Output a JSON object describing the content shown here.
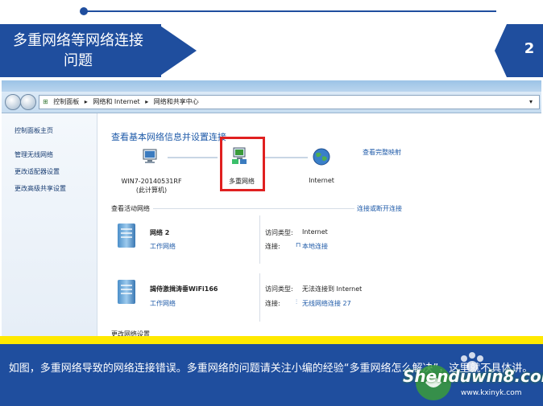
{
  "slide": {
    "title": "多重网络等网络连接问题",
    "number": "2",
    "caption": "如图，多重网络导致的网络连接错误。多重网络的问题请关注小编的经验“多重网络怎么解决”，这里就不具体讲。"
  },
  "window": {
    "breadcrumb": [
      "控制面板",
      "▸",
      "网络和 Internet",
      "▸",
      "网络和共享中心"
    ],
    "sidebar": {
      "home": "控制面板主页",
      "links": [
        "管理无线网络",
        "更改适配器设置",
        "更改高级共享设置"
      ]
    },
    "main_title": "查看基本网络信息并设置连接",
    "full_map_link": "查看完整映射",
    "map": {
      "computer_name": "WIN7-20140531RF",
      "computer_sub": "(此计算机)",
      "network_label": "多重网络",
      "internet_label": "Internet"
    },
    "active_section": "查看活动网络",
    "connect_link": "连接或断开连接",
    "networks": [
      {
        "name": "网络  2",
        "type": "工作网络",
        "access_key": "访问类型:",
        "access_value": "Internet",
        "conn_key": "连接:",
        "conn_value": "本地连接"
      },
      {
        "name": "謁侍激揖涛垂WiFi166",
        "type": "工作网络",
        "access_key": "访问类型:",
        "access_value": "无法连接到 Internet",
        "conn_key": "连接:",
        "conn_value": "无线网络连接 27"
      }
    ],
    "cutoff_text": "更改网络设置"
  },
  "watermark": {
    "text": "Shenduwin8.com",
    "sub": "www.kxinyk.com"
  }
}
